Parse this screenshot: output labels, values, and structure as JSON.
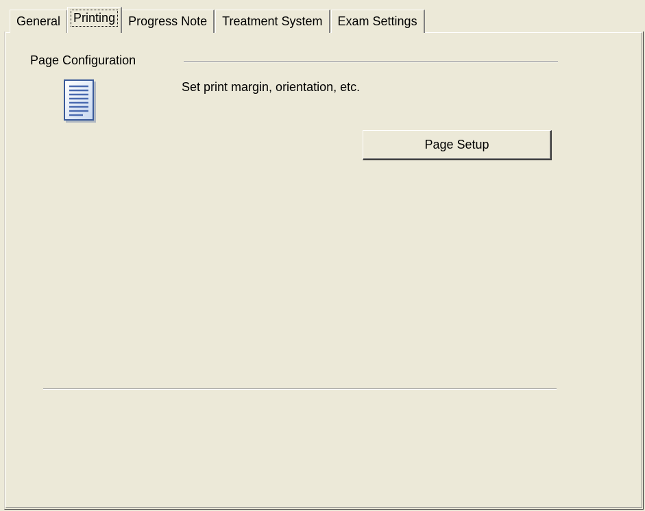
{
  "tabs": [
    {
      "label": "General"
    },
    {
      "label": "Printing"
    },
    {
      "label": "Progress Note"
    },
    {
      "label": "Treatment System"
    },
    {
      "label": "Exam Settings"
    }
  ],
  "active_tab": "Printing",
  "page_config": {
    "group_label": "Page Configuration",
    "description": "Set  print margin, orientation, etc.",
    "icon": "document-icon",
    "button_label": "Page Setup"
  },
  "colors": {
    "background": "#ece9d8",
    "highlight": "#ffffff",
    "shadow": "#808080"
  }
}
